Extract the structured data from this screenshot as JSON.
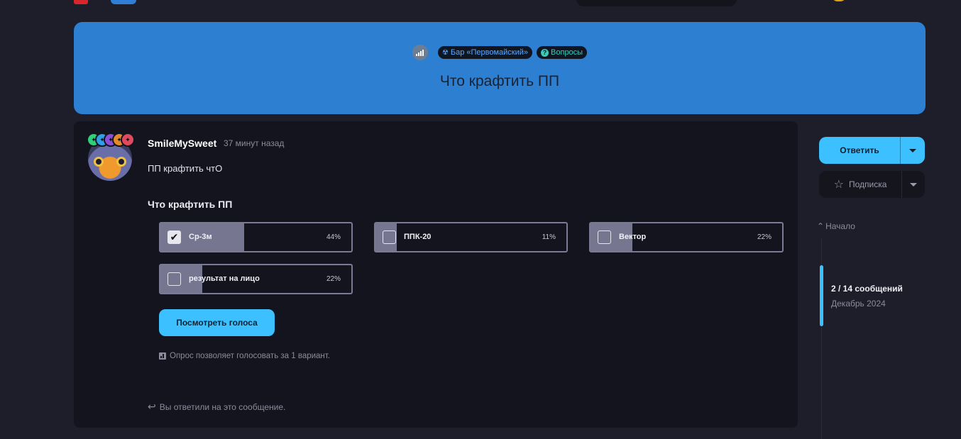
{
  "header": {
    "logo_icon": "site-logo"
  },
  "thread": {
    "tags": [
      {
        "icon": "radiation-icon",
        "label": "Бар «Первомайский»",
        "color": "#5aa8ff"
      },
      {
        "icon": "question-icon",
        "label": "Вопросы",
        "color": "#3ec9b8"
      }
    ],
    "title": "Что крафтить ПП",
    "hero_color": "#2d7fd2"
  },
  "post": {
    "author": "SmileMySweet",
    "time": "37 минут назад",
    "text": "ПП крафтить чтО",
    "poll": {
      "title": "Что крафтить ПП",
      "options": [
        {
          "label": "Ср-3м",
          "percent": "44%",
          "fraction": 0.44,
          "checked": true
        },
        {
          "label": "ППК-20",
          "percent": "11%",
          "fraction": 0.11,
          "checked": false
        },
        {
          "label": "Вектор",
          "percent": "22%",
          "fraction": 0.22,
          "checked": false
        },
        {
          "label": "результат на лицо",
          "percent": "22%",
          "fraction": 0.22,
          "checked": false
        }
      ],
      "votes_button": "Посмотреть голоса",
      "note": "Опрос позволяет голосовать за 1 вариант."
    },
    "replied_note": "Вы ответили на это сообщение."
  },
  "sidebar": {
    "reply_label": "Ответить",
    "subscribe_label": "Подписка",
    "timeline_start": "Начало",
    "timeline_count": "2 / 14 сообщений",
    "timeline_date": "Декабрь 2024",
    "accent": "#3cc0ff"
  }
}
